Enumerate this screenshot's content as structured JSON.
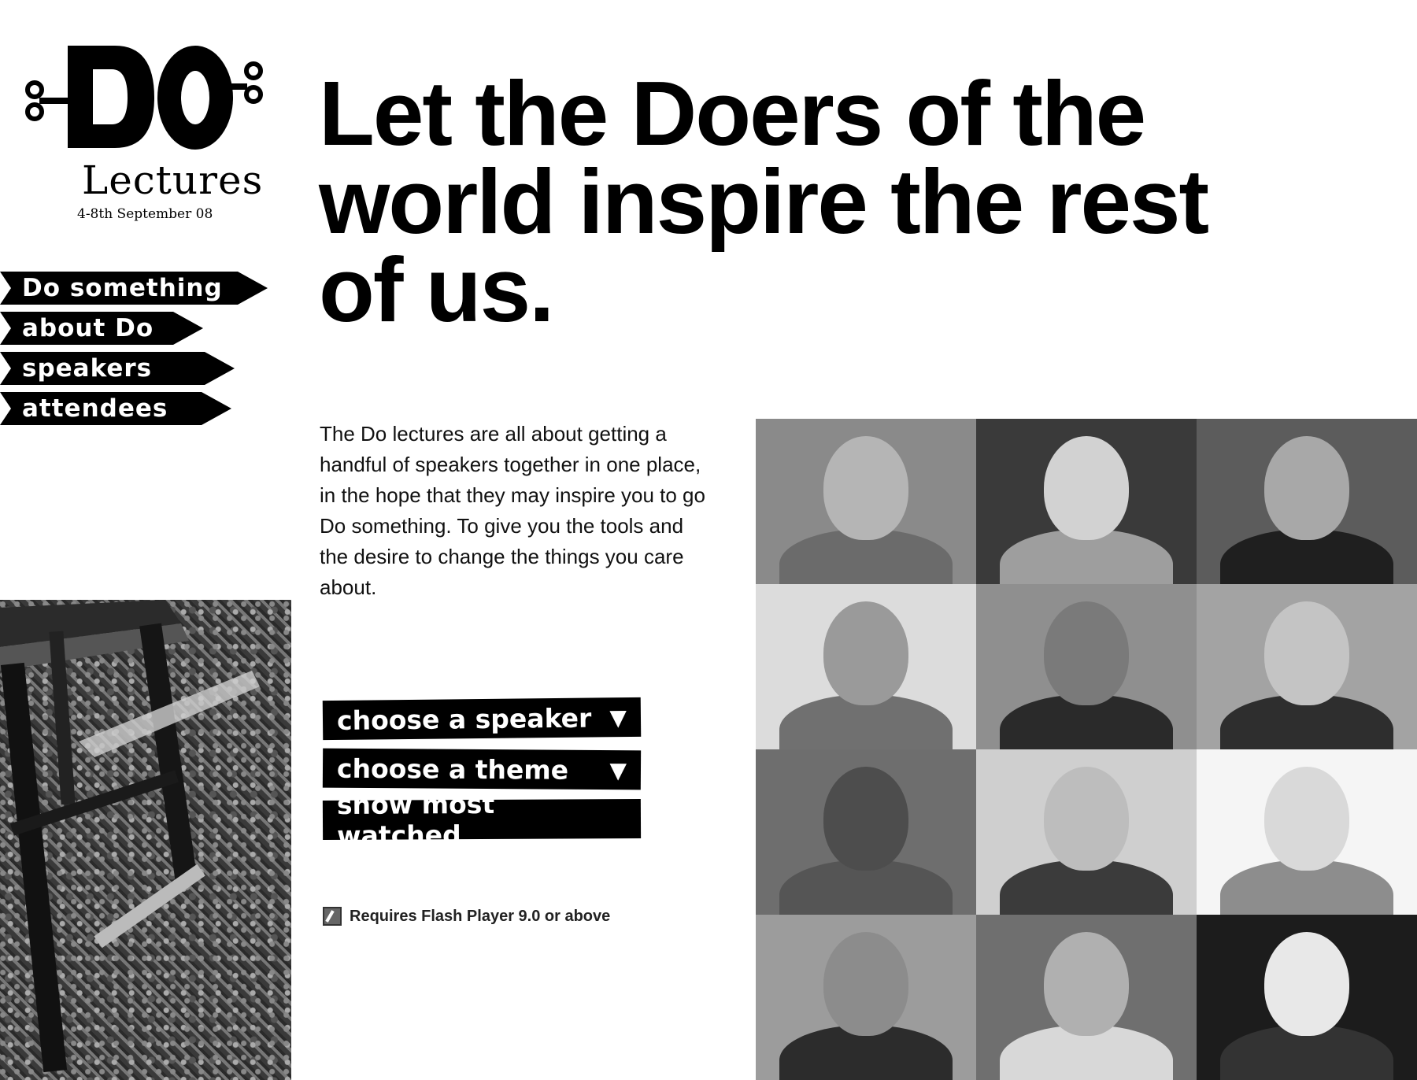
{
  "logo": {
    "mark": "DO",
    "word": "Lectures",
    "date": "4-8th September 08"
  },
  "nav": {
    "items": [
      {
        "label": "Do something"
      },
      {
        "label": "about Do"
      },
      {
        "label": "speakers"
      },
      {
        "label": "attendees"
      }
    ]
  },
  "headline": "Let the Doers of the world inspire the rest of us.",
  "intro": "The Do lectures are all about getting a handful of speakers together in one place, in the hope that they may inspire you to go Do something. To give you the tools and the desire to change the things you care about.",
  "actions": {
    "speaker": {
      "label": "choose a speaker",
      "caret": "▼"
    },
    "theme": {
      "label": "choose a theme",
      "caret": "▼"
    },
    "watched": {
      "label": "show most watched"
    }
  },
  "flash_note": "Requires Flash Player 9.0 or above",
  "speakers": [
    {
      "bg": "#8a8a8a",
      "face": "#b5b5b5",
      "body": "#6b6b6b"
    },
    {
      "bg": "#3a3a3a",
      "face": "#d2d2d2",
      "body": "#9e9e9e"
    },
    {
      "bg": "#5c5c5c",
      "face": "#a8a8a8",
      "body": "#1f1f1f"
    },
    {
      "bg": "#dcdcdc",
      "face": "#9a9a9a",
      "body": "#707070"
    },
    {
      "bg": "#8f8f8f",
      "face": "#7a7a7a",
      "body": "#2a2a2a"
    },
    {
      "bg": "#a3a3a3",
      "face": "#c4c4c4",
      "body": "#2e2e2e"
    },
    {
      "bg": "#6e6e6e",
      "face": "#4d4d4d",
      "body": "#555555"
    },
    {
      "bg": "#cfcfcf",
      "face": "#bdbdbd",
      "body": "#3b3b3b"
    },
    {
      "bg": "#f5f5f5",
      "face": "#d9d9d9",
      "body": "#8d8d8d"
    },
    {
      "bg": "#9c9c9c",
      "face": "#8c8c8c",
      "body": "#2c2c2c"
    },
    {
      "bg": "#6f6f6f",
      "face": "#b0b0b0",
      "body": "#d8d8d8"
    },
    {
      "bg": "#1c1c1c",
      "face": "#e8e8e8",
      "body": "#333333"
    }
  ]
}
